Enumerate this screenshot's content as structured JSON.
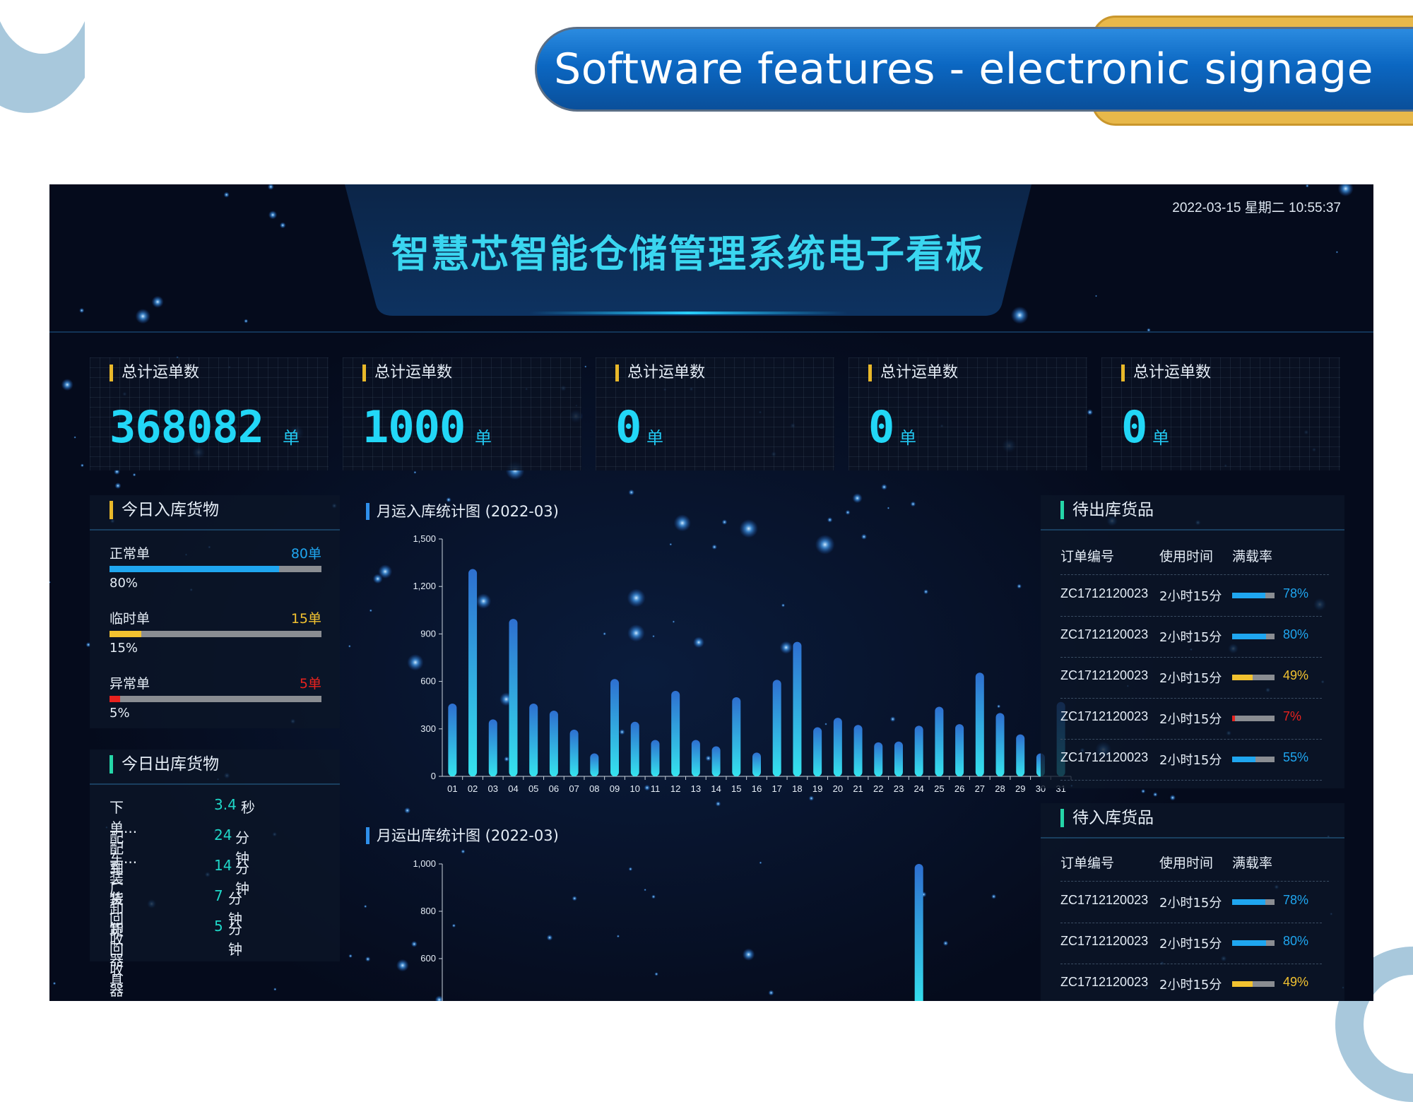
{
  "slide": {
    "title": "Software features - electronic signage"
  },
  "dashboard": {
    "title": "智慧芯智能仓储管理系统电子看板",
    "datetime": "2022-03-15  星期二  10:55:37",
    "stats": [
      {
        "label": "总计运单数",
        "value": "368082",
        "unit": "单"
      },
      {
        "label": "总计运单数",
        "value": "1000",
        "unit": "单"
      },
      {
        "label": "总计运单数",
        "value": "0",
        "unit": "单"
      },
      {
        "label": "总计运单数",
        "value": "0",
        "unit": "单"
      },
      {
        "label": "总计运单数",
        "value": "0",
        "unit": "单"
      }
    ],
    "inbound_today": {
      "title": "今日入库货物",
      "items": [
        {
          "name": "正常单",
          "count": "80单",
          "percent_label": "80%",
          "percent": 80,
          "color": "#1fa6f0"
        },
        {
          "name": "临时单",
          "count": "15单",
          "percent_label": "15%",
          "percent": 15,
          "color": "#f2c230"
        },
        {
          "name": "异常单",
          "count": "5单",
          "percent_label": "5%",
          "percent": 5,
          "color": "#e8221e"
        }
      ]
    },
    "outbound_today": {
      "title": "今日出库货物",
      "items": [
        {
          "name": "下单...配车",
          "value": "3.4",
          "unit": "秒"
        },
        {
          "name": "配车...装货",
          "value": "24",
          "unit": "分钟"
        },
        {
          "name": "到厂卸货",
          "value": "14",
          "unit": "分钟"
        },
        {
          "name": "装回收器具",
          "value": "7",
          "unit": "分钟"
        },
        {
          "name": "卸回收器具",
          "value": "5",
          "unit": "分钟"
        }
      ]
    },
    "pending_outbound": {
      "title": "待出库货品",
      "columns": [
        "订单编号",
        "使用时间",
        "满载率"
      ],
      "rows": [
        {
          "order": "ZC1712120023",
          "time": "2小时15分",
          "rate_label": "78%",
          "rate": 78,
          "color": "#1fa6f0"
        },
        {
          "order": "ZC1712120023",
          "time": "2小时15分",
          "rate_label": "80%",
          "rate": 80,
          "color": "#1fa6f0"
        },
        {
          "order": "ZC1712120023",
          "time": "2小时15分",
          "rate_label": "49%",
          "rate": 49,
          "color": "#f2c230"
        },
        {
          "order": "ZC1712120023",
          "time": "2小时15分",
          "rate_label": "7%",
          "rate": 7,
          "color": "#e8221e"
        },
        {
          "order": "ZC1712120023",
          "time": "2小时15分",
          "rate_label": "55%",
          "rate": 55,
          "color": "#1fa6f0"
        }
      ]
    },
    "pending_inbound": {
      "title": "待入库货品",
      "columns": [
        "订单编号",
        "使用时间",
        "满载率"
      ],
      "rows": [
        {
          "order": "ZC1712120023",
          "time": "2小时15分",
          "rate_label": "78%",
          "rate": 78,
          "color": "#1fa6f0"
        },
        {
          "order": "ZC1712120023",
          "time": "2小时15分",
          "rate_label": "80%",
          "rate": 80,
          "color": "#1fa6f0"
        },
        {
          "order": "ZC1712120023",
          "time": "2小时15分",
          "rate_label": "49%",
          "rate": 49,
          "color": "#f2c230"
        }
      ]
    }
  },
  "chart_data": [
    {
      "type": "bar",
      "title": "月运入库统计图 (2022-03)",
      "categories": [
        "01",
        "02",
        "03",
        "04",
        "05",
        "06",
        "07",
        "08",
        "09",
        "10",
        "11",
        "12",
        "13",
        "14",
        "15",
        "16",
        "17",
        "18",
        "19",
        "20",
        "21",
        "22",
        "23",
        "24",
        "25",
        "26",
        "27",
        "28",
        "29",
        "30",
        "31"
      ],
      "values": [
        460,
        1310,
        360,
        995,
        460,
        415,
        295,
        145,
        615,
        345,
        230,
        540,
        230,
        190,
        500,
        150,
        610,
        850,
        310,
        370,
        325,
        215,
        220,
        320,
        440,
        330,
        655,
        400,
        265,
        145,
        470
      ],
      "yticks": [
        "0",
        "300",
        "600",
        "900",
        "1,200",
        "1,500"
      ],
      "ylim": [
        0,
        1500
      ],
      "colors": {
        "top": "#2e6fd0",
        "bottom": "#35e3ee"
      }
    },
    {
      "type": "bar",
      "title": "月运出库统计图 (2022-03)",
      "yticks": [
        "600",
        "800",
        "1,000"
      ],
      "ylim": [
        0,
        1000
      ],
      "visible_bars": [
        {
          "category": "24",
          "value": 1000
        }
      ],
      "colors": {
        "top": "#2e6fd0",
        "bottom": "#35e3ee"
      }
    }
  ]
}
